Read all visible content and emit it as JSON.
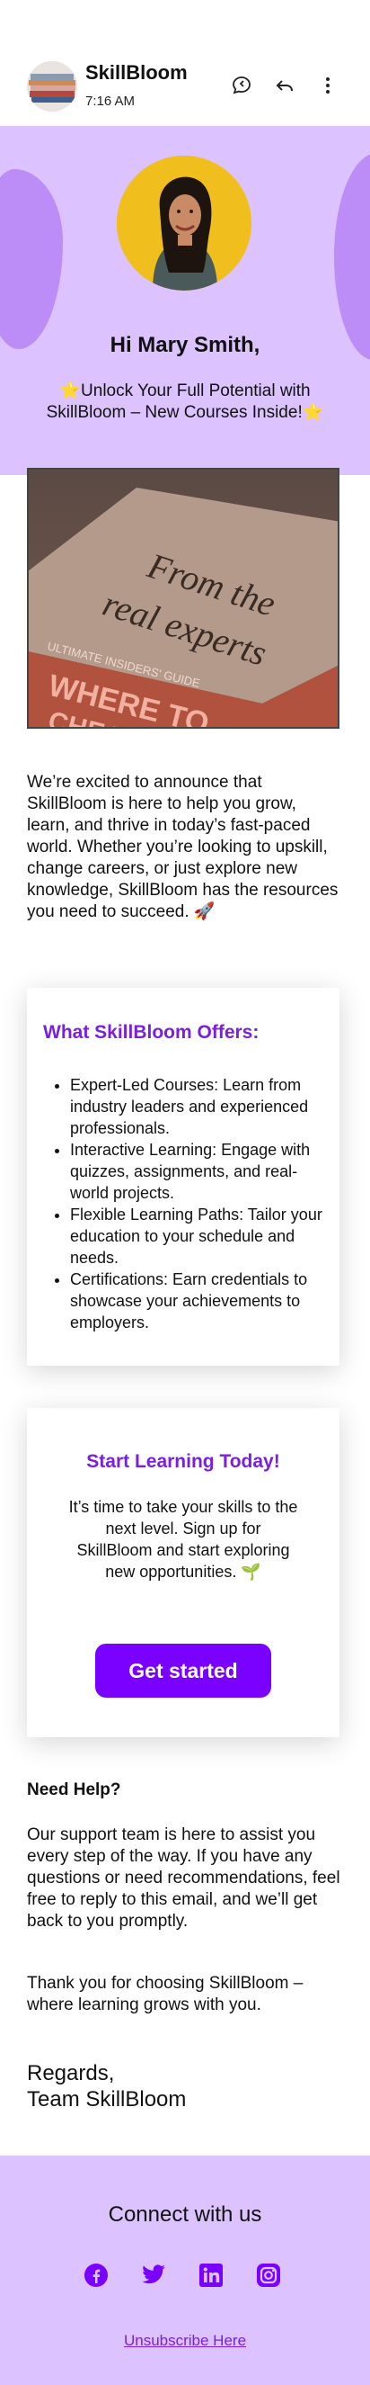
{
  "header": {
    "sender_name": "SkillBloom",
    "time": "7:16 AM",
    "sender_avatar_icon": "books-stack-avatar",
    "actions": [
      "chat-bubble-icon",
      "reply-icon",
      "more-vertical-icon"
    ]
  },
  "hero": {
    "profile_photo": "woman-portrait-photo",
    "greeting": "Hi Mary Smith,",
    "subject": "⭐Unlock Your Full Potential with SkillBloom – New Courses Inside!⭐",
    "background_color": "#dcc2ff",
    "blob_color": "#bc8df6"
  },
  "feature_image": {
    "description_icon": "book-from-the-real-experts-photo"
  },
  "intro": "We’re excited to announce that SkillBloom is here to help you grow, learn, and thrive in today’s fast-paced world. Whether you’re looking to upskill, change careers, or just explore new knowledge, SkillBloom has the resources you need to succeed. 🚀",
  "offers": {
    "title": "What SkillBloom Offers:",
    "items": [
      "Expert-Led Courses: Learn from industry leaders and experienced professionals.",
      "Interactive Learning: Engage with quizzes, assignments, and real-world projects.",
      "Flexible Learning Paths: Tailor your education to your schedule and needs.",
      "Certifications: Earn credentials to showcase your achievements to employers."
    ]
  },
  "cta": {
    "title": "Start Learning Today!",
    "text": "It’s time to take your skills to the next level. Sign up for SkillBloom and start exploring new opportunities. 🌱",
    "button_label": "Get started",
    "accent_color": "#7a00ff"
  },
  "help": {
    "title": "Need Help?",
    "text": "Our support team is here to assist you every step of the way. If you have any questions or need recommendations, feel free to reply to this email, and we’ll get back to you promptly.",
    "thanks": "Thank you for choosing SkillBloom – where learning grows with you."
  },
  "regards": {
    "line1": "Regards,",
    "line2": "Team SkillBloom"
  },
  "footer": {
    "connect_title": "Connect with us",
    "social_icons": [
      "facebook-icon",
      "twitter-icon",
      "linkedin-icon",
      "instagram-icon"
    ],
    "unsubscribe": "Unsubscribe Here"
  }
}
